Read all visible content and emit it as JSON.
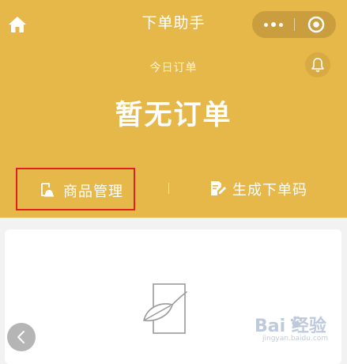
{
  "app": {
    "title": "下单助手"
  },
  "nav": {
    "home_icon": "home-icon",
    "capsule_more_icon": "more-dots-icon",
    "capsule_close_icon": "target-circle-icon",
    "bell_icon": "bell-icon"
  },
  "summary": {
    "today_label": "今日订单",
    "status_text": "暂无订单"
  },
  "actions": [
    {
      "label": "商品管理",
      "icon": "product-manage-icon",
      "highlighted": true
    },
    {
      "label": "生成下单码",
      "icon": "generate-code-icon",
      "highlighted": false
    }
  ],
  "empty_state": {
    "icon": "empty-leaf-document-icon"
  },
  "floating": {
    "back_icon": "chevron-left-icon"
  },
  "watermark": {
    "brand": "Bai  经验",
    "url": "jingyan.baidu.com"
  },
  "colors": {
    "header_bg": "#e6b84a",
    "highlight_border": "#e02020",
    "page_bg": "#f2f2f2",
    "card_bg": "#ffffff"
  }
}
